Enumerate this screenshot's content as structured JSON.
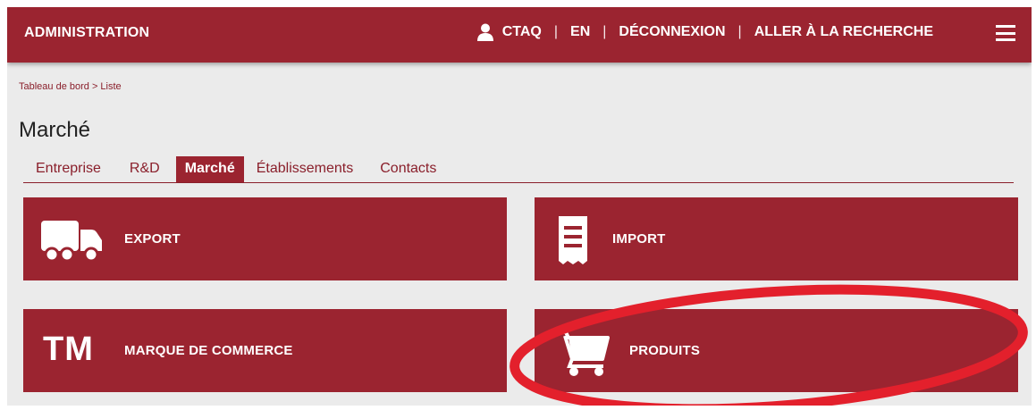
{
  "header": {
    "brand": "ADMINISTRATION",
    "user_label": "CTAQ",
    "separator": "|",
    "lang_label": "EN",
    "logout_label": "DÉCONNEXION",
    "search_label": "ALLER À LA RECHERCHE"
  },
  "breadcrumb": "Tableau de bord > Liste",
  "page_title": "Marché",
  "tabs": [
    {
      "label": "Entreprise"
    },
    {
      "label": "R&D"
    },
    {
      "label": "Marché"
    },
    {
      "label": "Établissements"
    },
    {
      "label": "Contacts"
    }
  ],
  "active_tab": "Marché",
  "tiles": {
    "export": {
      "label": "EXPORT",
      "icon": "truck-icon"
    },
    "import": {
      "label": "IMPORT",
      "icon": "receipt-icon"
    },
    "marque": {
      "label": "MARQUE DE COMMERCE",
      "icon_text": "TM",
      "icon": "trademark-icon"
    },
    "produits": {
      "label": "PRODUITS",
      "icon": "cart-icon"
    }
  },
  "colors": {
    "brand": "#9b2430",
    "background": "#ebebeb",
    "annotation": "#e3202c"
  }
}
